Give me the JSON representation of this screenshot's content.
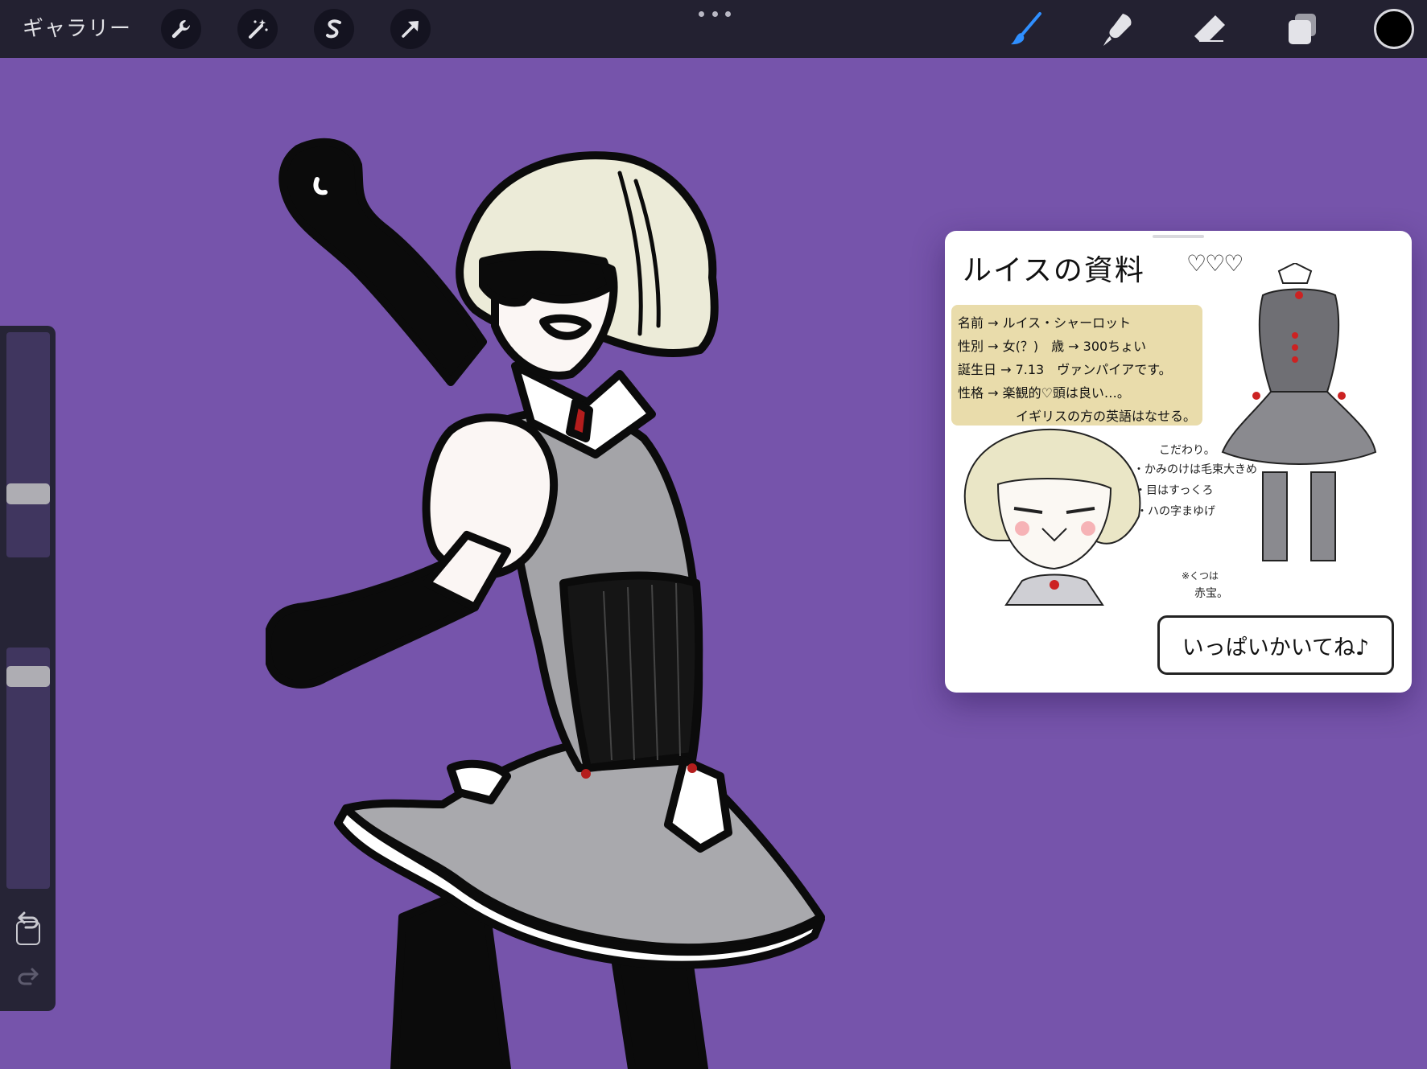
{
  "toolbar": {
    "gallery_label": "ギャラリー",
    "left_tools": [
      {
        "name": "actions",
        "icon": "wrench-icon"
      },
      {
        "name": "adjustments",
        "icon": "magic-wand-icon"
      },
      {
        "name": "selection",
        "icon": "selection-s-icon"
      },
      {
        "name": "transform",
        "icon": "arrow-cursor-icon"
      }
    ],
    "more_icon": "more-dots-icon",
    "right_tools": [
      {
        "name": "brush",
        "icon": "brush-icon",
        "active": true
      },
      {
        "name": "smudge",
        "icon": "smudge-icon",
        "active": false
      },
      {
        "name": "eraser",
        "icon": "eraser-icon",
        "active": false
      },
      {
        "name": "layers",
        "icon": "layers-icon",
        "active": false
      }
    ],
    "current_color": "#000000",
    "active_tool_color": "#2f8fff"
  },
  "sidebar": {
    "brush_size_level": 0.7,
    "opacity_level": 0.96,
    "modify_icon": "square-icon",
    "undo_icon": "undo-icon",
    "redo_icon": "redo-icon"
  },
  "canvas": {
    "background_color": "#7654ab"
  },
  "reference": {
    "title": "ルイスの資料",
    "hearts": "♡♡♡",
    "info_lines": [
      "名前 → ルイス・シャーロット",
      "性別 → 女(？)　歳 → 300ちょい",
      "誕生日 → 7.13　ヴァンパイアです。",
      "性格 → 楽観的♡頭は良い…。",
      "イギリスの方の英語はなせる。"
    ],
    "notes_header": "こだわり。",
    "notes": [
      "・かみのけは毛束大きめ",
      "・目はすっくろ",
      "・ハの字まゆげ"
    ],
    "gem_note": "※くつは",
    "gem_note_2": "赤宝。",
    "speech": "いっぱいかいてね♪"
  }
}
